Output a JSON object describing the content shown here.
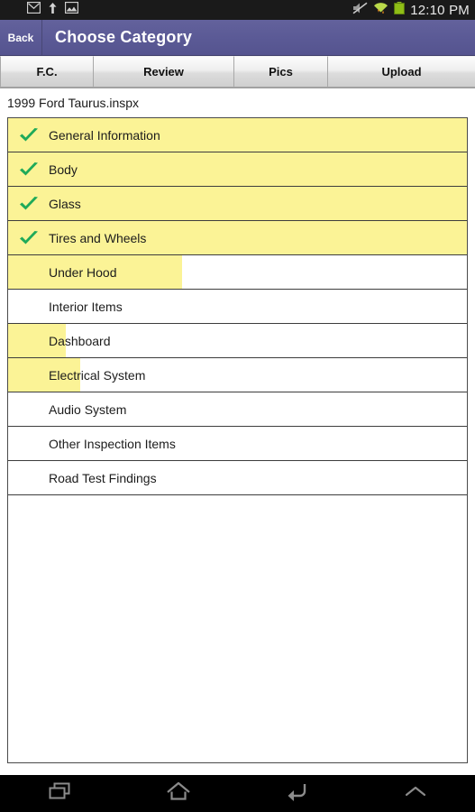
{
  "status_bar": {
    "left_icons": [
      "mail-icon",
      "upload-icon",
      "image-icon"
    ],
    "right_icons": [
      "mute-icon",
      "wifi-icon",
      "battery-icon"
    ],
    "time": "12:10 PM",
    "background": "#1a1a1a"
  },
  "action_bar": {
    "back_label": "Back",
    "title": "Choose Category",
    "background": "#5b5a96"
  },
  "tabs": [
    {
      "label": "F.C."
    },
    {
      "label": "Review"
    },
    {
      "label": "Pics"
    },
    {
      "label": "Upload"
    }
  ],
  "file_name": "1999 Ford Taurus.inspx",
  "colors": {
    "progress_fill": "#fbf396",
    "check_green": "#1faa59",
    "accent": "#5b5a96"
  },
  "categories": [
    {
      "label": "General Information",
      "checked": true,
      "progress": 100
    },
    {
      "label": "Body",
      "checked": true,
      "progress": 100
    },
    {
      "label": "Glass",
      "checked": true,
      "progress": 100
    },
    {
      "label": "Tires and Wheels",
      "checked": true,
      "progress": 100
    },
    {
      "label": "Under Hood",
      "checked": false,
      "progress": 38
    },
    {
      "label": "Interior Items",
      "checked": false,
      "progress": 0
    },
    {
      "label": "Dashboard",
      "checked": false,
      "progress": 12.5
    },
    {
      "label": "Electrical System",
      "checked": false,
      "progress": 15.7
    },
    {
      "label": "Audio System",
      "checked": false,
      "progress": 0
    },
    {
      "label": "Other Inspection Items",
      "checked": false,
      "progress": 0
    },
    {
      "label": "Road Test Findings",
      "checked": false,
      "progress": 0
    }
  ],
  "nav_bar": {
    "buttons": [
      "recents-icon",
      "home-icon",
      "back-icon",
      "chevron-up-icon"
    ],
    "background": "#000000"
  }
}
